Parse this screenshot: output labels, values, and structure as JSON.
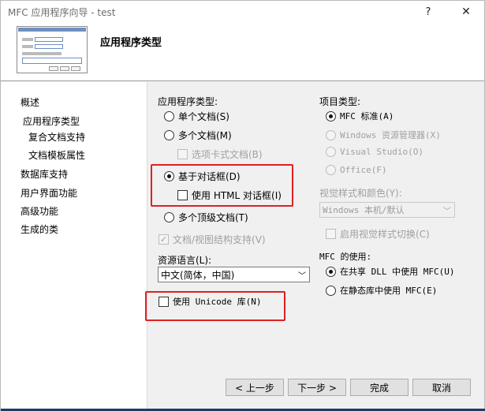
{
  "window": {
    "title": "MFC 应用程序向导 - test",
    "help_glyph": "?",
    "close_glyph": "✕"
  },
  "banner": {
    "title": "应用程序类型"
  },
  "nav": {
    "items": [
      {
        "label": "概述"
      },
      {
        "label": "应用程序类型"
      },
      {
        "label": "复合文档支持"
      },
      {
        "label": "文档模板属性"
      },
      {
        "label": "数据库支持"
      },
      {
        "label": "用户界面功能"
      },
      {
        "label": "高级功能"
      },
      {
        "label": "生成的类"
      }
    ]
  },
  "app_type": {
    "group_label": "应用程序类型:",
    "single_doc": "单个文档(S)",
    "multi_doc": "多个文档(M)",
    "tabbed_docs": "选项卡式文档(B)",
    "dialog_based": "基于对话框(D)",
    "use_html_dialog": "使用 HTML 对话框(I)",
    "multi_toplevel": "多个顶级文档(T)",
    "doc_view_support": "文档/视图结构支持(V)",
    "check_mark": "✓"
  },
  "resource_language": {
    "label": "资源语言(L):",
    "selected": "中文(简体，中国)",
    "arrow_glyph": "﹀"
  },
  "unicode": {
    "label": "使用 Unicode 库(N)"
  },
  "project_type": {
    "group_label": "项目类型:",
    "mfc_standard": "MFC 标准(A)",
    "windows_explorer": "Windows 资源管理器(X)",
    "visual_studio": "Visual Studio(O)",
    "office": "Office(F)"
  },
  "visual_style": {
    "label": "视觉样式和颜色(Y):",
    "selected": "Windows 本机/默认",
    "arrow_glyph": "﹀",
    "enable_switch": "启用视觉样式切换(C)"
  },
  "mfc_use": {
    "group_label": "MFC 的使用:",
    "shared_dll": "在共享 DLL 中使用 MFC(U)",
    "static_lib": "在静态库中使用 MFC(E)"
  },
  "buttons": {
    "prev": "< 上一步",
    "next": "下一步 >",
    "finish": "完成",
    "cancel": "取消"
  }
}
